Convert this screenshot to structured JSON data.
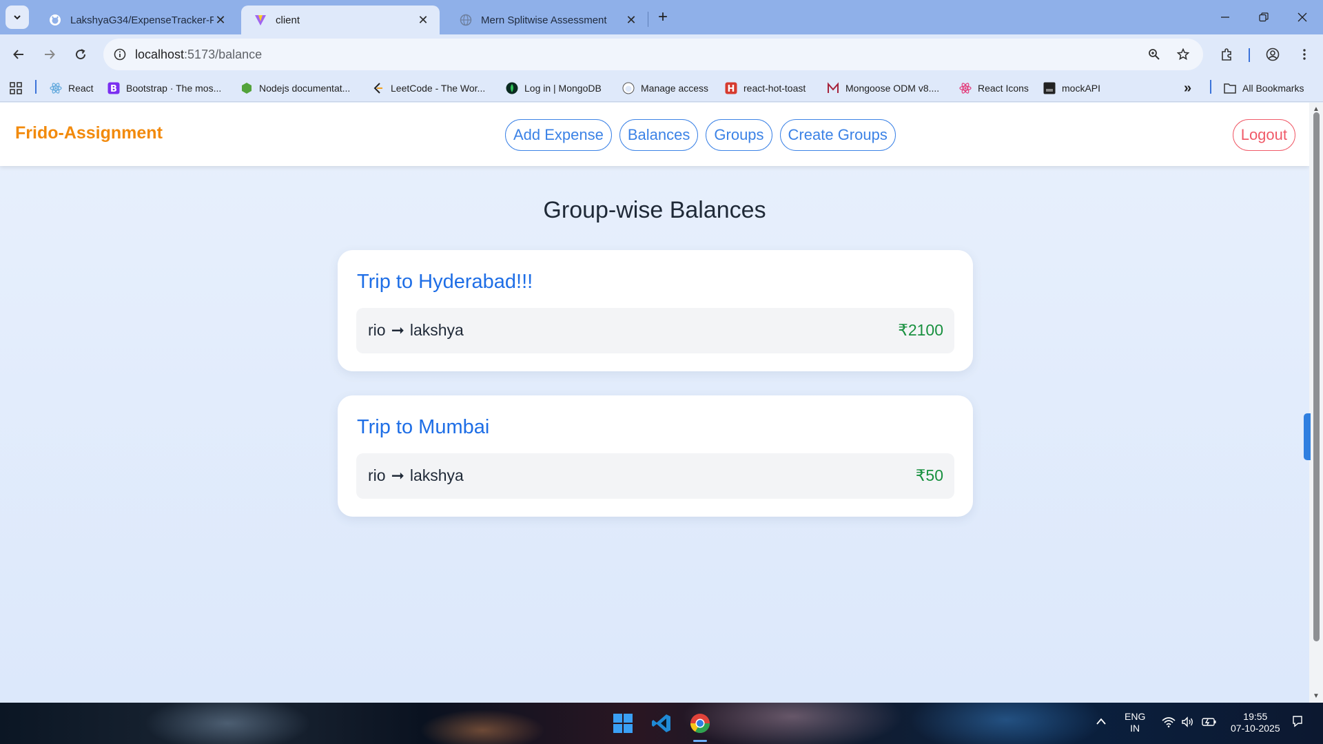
{
  "browser": {
    "tabs": [
      {
        "title": "LakshyaG34/ExpenseTracker-Fri",
        "favicon": "github-icon",
        "active": false
      },
      {
        "title": "client",
        "favicon": "vite-icon",
        "active": true
      },
      {
        "title": "Mern Splitwise Assessment",
        "favicon": "globe-icon",
        "active": false
      }
    ],
    "url_host": "localhost",
    "url_path": ":5173/balance",
    "bookmarks": [
      {
        "label": "React",
        "icon": "react-icon"
      },
      {
        "label": "Bootstrap · The mos...",
        "icon": "bootstrap-icon"
      },
      {
        "label": "Nodejs documentat...",
        "icon": "nodejs-icon"
      },
      {
        "label": "LeetCode - The Wor...",
        "icon": "leetcode-icon"
      },
      {
        "label": "Log in | MongoDB",
        "icon": "mongodb-icon"
      },
      {
        "label": "Manage access",
        "icon": "github-icon"
      },
      {
        "label": "react-hot-toast",
        "icon": "hot-toast-icon"
      },
      {
        "label": "Mongoose ODM v8....",
        "icon": "mongoose-icon"
      },
      {
        "label": "React Icons",
        "icon": "react-icons-icon"
      },
      {
        "label": "mockAPI",
        "icon": "mockapi-icon"
      }
    ],
    "all_bookmarks": "All Bookmarks"
  },
  "app": {
    "brand": "Frido-Assignment",
    "nav": [
      "Add Expense",
      "Balances",
      "Groups",
      "Create Groups"
    ],
    "logout": "Logout",
    "heading": "Group-wise Balances",
    "groups": [
      {
        "name": "Trip to Hyderabad!!!",
        "balances": [
          {
            "from": "rio",
            "arrow": "➞",
            "to": "lakshya",
            "amount": "₹2100"
          }
        ]
      },
      {
        "name": "Trip to Mumbai",
        "balances": [
          {
            "from": "rio",
            "arrow": "➞",
            "to": "lakshya",
            "amount": "₹50"
          }
        ]
      }
    ]
  },
  "taskbar": {
    "lang_line1": "ENG",
    "lang_line2": "IN",
    "time": "19:55",
    "date": "07-10-2025"
  },
  "colors": {
    "brand": "#f28a0c",
    "nav_accent": "#3b82e6",
    "logout": "#f05a68",
    "group_title": "#1e6ee6",
    "amount": "#18903f"
  }
}
